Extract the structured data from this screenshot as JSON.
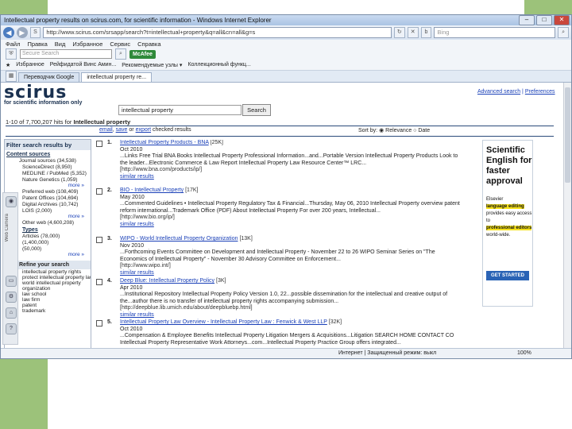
{
  "browser": {
    "title": "Intellectual property results on scirus.com, for scientific information - Windows Internet Explorer",
    "url": "http://www.scirus.com/srsapp/search?t=intellectual+property&q=all&cn=all&g=s",
    "search_engine_placeholder": "Bing",
    "menu": [
      "Файл",
      "Правка",
      "Вид",
      "Избранное",
      "Сервис",
      "Справка"
    ],
    "secure_search_placeholder": "Secure Search",
    "mcafee_label": "McAfee",
    "favorites": [
      "Избранное",
      "Рейфидатой Винс Амин...",
      "Рекомендуемые узлы ▾",
      "Коллекционный функц..."
    ],
    "tabs": [
      "Переводчик Google",
      "intellectual property re..."
    ],
    "status_zone": "Интернет | Защищенный режим: выкл",
    "zoom": "100%"
  },
  "scirus": {
    "logo": "scirus",
    "tagline": "for scientific information only",
    "query": "intellectual property",
    "search_button": "Search",
    "advanced_link": "Advanced search",
    "preferences_link": "Preferences",
    "hits_prefix": "1-10 of 7,700,207 hits for",
    "hits_query": "Intellectual property",
    "actions": {
      "email": "email",
      "save": "save",
      "export": "export",
      "suffix": "checked results",
      "or": "or"
    },
    "sort": {
      "label": "Sort by:",
      "relevance": "Relevance",
      "date": "Date"
    },
    "sidebar": {
      "title": "Filter search results by",
      "content_sources": "Content sources",
      "journal_sources": "Journal sources (34,538)",
      "journal_items": [
        "ScienceDirect (8,950)",
        "MEDLINE / PubMed (5,352)",
        "Nature Genetics (1,059)"
      ],
      "more": "more »",
      "preferred_web": "Preferred web (108,409)",
      "web_items": [
        "Patent Offices (104,694)",
        "Digital Archives (10,742)",
        "LOIS (2,000)"
      ],
      "other_web": "Other web (4,600,208)",
      "types": "Types",
      "type_items": [
        "Articles (78,000)",
        "(1,400,000)",
        "(50,000)"
      ],
      "refine": "Refine your search",
      "refine_items": [
        "intellectual property rights",
        "protect intellectual property law",
        "world intellectual property",
        "organization",
        "law school",
        "law firm",
        "patent",
        "trademark"
      ]
    },
    "results": [
      {
        "number": "1.",
        "title": "Intellectual Property Products - BNA",
        "tag": "[25K]",
        "date": "Oct 2010",
        "snippet": "...Links Free Trial BNA Books Intellectual Property Professional Information...and...Portable Version Intellectual Property Products Look to the leader...Electronic Commerce & Law Report Intellectual Property Law Resource Center™ LRC...",
        "url": "[http://www.bna.com/products/ip/]",
        "similar": "similar results"
      },
      {
        "number": "2.",
        "title": "BIO - Intellectual Property",
        "tag": "[17K]",
        "date": "May 2010",
        "snippet": "...Commented Guidelines • Intellectual Property Regulatory Tax & Financial...Thursday, May 06, 2010 Intellectual Property overview patent reform international...Trademark Office (PDF) About Intellectual Property For over 200 years, Intellectual...",
        "url": "[http://www.bio.org/ip/]",
        "similar": "similar results"
      },
      {
        "number": "3.",
        "title": "WIPO - World Intellectual Property Organization",
        "tag": "[13K]",
        "date": "Nov 2010",
        "snippet": "...Forthcoming Events Committee on Development and Intellectual Property - November 22 to 26 WIPO Seminar Series on \"The Economics of Intellectual Property\" - November 30 Advisory Committee on Enforcement...",
        "url": "[http://www.wipo.int/]",
        "similar": "similar results"
      },
      {
        "number": "4.",
        "title": "Deep Blue: Intellectual Property Policy",
        "tag": "[3K]",
        "date": "Apr 2010",
        "snippet": "...Institutional Repository Intellectual Property Policy Version 1.0, 22...possible dissemination for the intellectual and creative output of the...author there is no transfer of intellectual property rights accompanying submission...",
        "url": "[http://deepblue.lib.umich.edu/about/deepbluebp.html]",
        "similar": "similar results"
      },
      {
        "number": "5.",
        "title": "Intellectual Property Law Overview - Intellectual Property Law : Fenwick & West LLP",
        "tag": "[32K]",
        "date": "Oct 2010",
        "snippet": "...Compensation & Employee Benefits Intellectual Property Litigation Mergers & Acquisitions...Litigation SEARCH HOME CONTACT CO Intellectual Property Representative Work Attorneys...com...Intellectual Property Practice Group offers integrated...",
        "url": "",
        "similar": ""
      }
    ],
    "ad": {
      "headline": "Scientific English for faster approval",
      "line1": "Elsevier",
      "hl1": "language editing",
      "line2": "provides easy access to",
      "hl2": "professional editors",
      "line3": "world-wide.",
      "button": "GET STARTED"
    }
  },
  "colors": {
    "accent": "#9cc27a",
    "link": "#1a40b8",
    "brand": "#19304f"
  }
}
